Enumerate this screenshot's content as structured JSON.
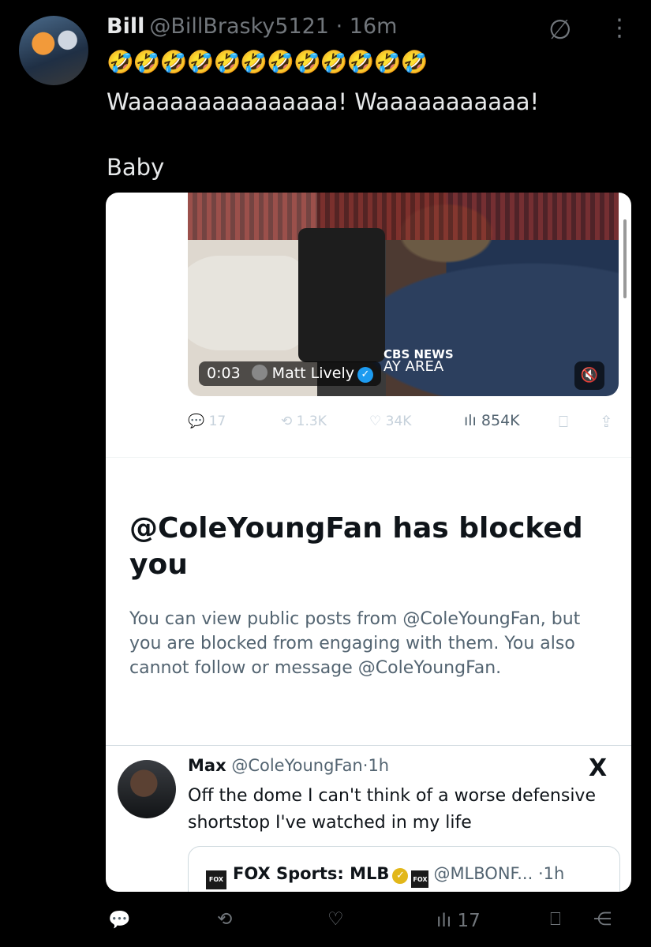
{
  "post": {
    "author_name": "Bill",
    "author_handle": "@BillBrasky5121",
    "separator": "·",
    "time": "16m",
    "emojis": "🤣🤣🤣🤣🤣🤣🤣🤣🤣🤣🤣🤣",
    "text_line1": "Waaaaaaaaaaaaaaa! Waaaaaaaaaaa!",
    "text_line2": "Baby"
  },
  "top_icons": {
    "grok_icon": "∅",
    "more_icon": "⋮"
  },
  "embed": {
    "video": {
      "time": "0:03",
      "credit": "Matt Lively",
      "verified_mark": "✓",
      "watermark_line1": "CBS NEWS",
      "watermark_line2": "AY AREA",
      "mute_icon": "🔇"
    },
    "stats": {
      "replies": "17",
      "reposts": "1.3K",
      "likes": "34K",
      "views": "854K"
    },
    "blocked": {
      "title": "@ColeYoungFan has blocked you",
      "body": "You can view public posts from @ColeYoungFan, but you are blocked from engaging with them. You also cannot follow or message @ColeYoungFan."
    },
    "quoted_post": {
      "name": "Max",
      "handle": "@ColeYoungFan",
      "separator": "·",
      "time": "1h",
      "x_logo": "X",
      "text": "Off the dome I can't think of a worse defensive shortstop I've watched in my life",
      "inner": {
        "logo_text": "FOX",
        "name": "FOX Sports: MLB",
        "badge_text": "FOX",
        "handle": "@MLBONF...",
        "separator": "·",
        "time": "1h"
      }
    }
  },
  "actions": {
    "reply_icon": "💬",
    "repost_icon": "⟲",
    "like_icon": "♡",
    "views_icon": "ılı",
    "views": "17",
    "bookmark_icon": "⎕",
    "share_icon": "⋲"
  }
}
